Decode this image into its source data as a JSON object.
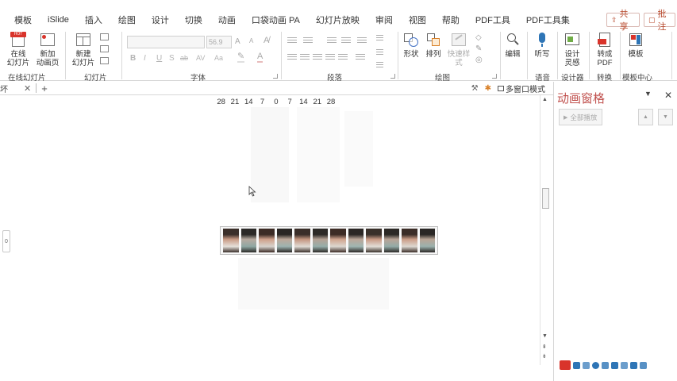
{
  "menu": {
    "items": [
      "模板",
      "iSlide",
      "插入",
      "绘图",
      "设计",
      "切换",
      "动画",
      "口袋动画 PA",
      "幻灯片放映",
      "审阅",
      "视图",
      "帮助",
      "PDF工具",
      "PDF工具集"
    ],
    "share_label": "共享",
    "comment_label": "批注"
  },
  "ribbon": {
    "online_slide": {
      "line1": "在线",
      "line2": "幻灯片",
      "badge": "HOT"
    },
    "new_anim_page": {
      "line1": "新加",
      "line2": "动画页"
    },
    "new_slide": {
      "line1": "新建",
      "line2": "幻灯片"
    },
    "font_size": "56.9",
    "format_letters": [
      "B",
      "I",
      "U",
      "S",
      "ab",
      "AV",
      "Aa"
    ],
    "shape": "形状",
    "arrange": "排列",
    "quick_style": "快速样式",
    "edit": "编辑",
    "dictate": "听写",
    "designer": {
      "line1": "设计",
      "line2": "灵感"
    },
    "to_pdf": {
      "line1": "转成",
      "line2": "PDF"
    },
    "template": "模板",
    "groups": [
      "在线幻灯片",
      "幻灯片",
      "字体",
      "段落",
      "绘图",
      "语音",
      "设计器",
      "转换",
      "模板中心"
    ]
  },
  "tabbar": {
    "tab_label": "坏",
    "multi_window": "多窗口模式"
  },
  "ruler": [
    "28",
    "21",
    "14",
    "7",
    "0",
    "7",
    "14",
    "21",
    "28"
  ],
  "left_marker": "0",
  "filmstrip_frames": 12,
  "pane": {
    "title": "动画窗格",
    "play_all": "全部播放"
  },
  "colors": {
    "accent": "#c0504d",
    "share_border": "#d9b7b1",
    "share_text": "#b7472a"
  }
}
